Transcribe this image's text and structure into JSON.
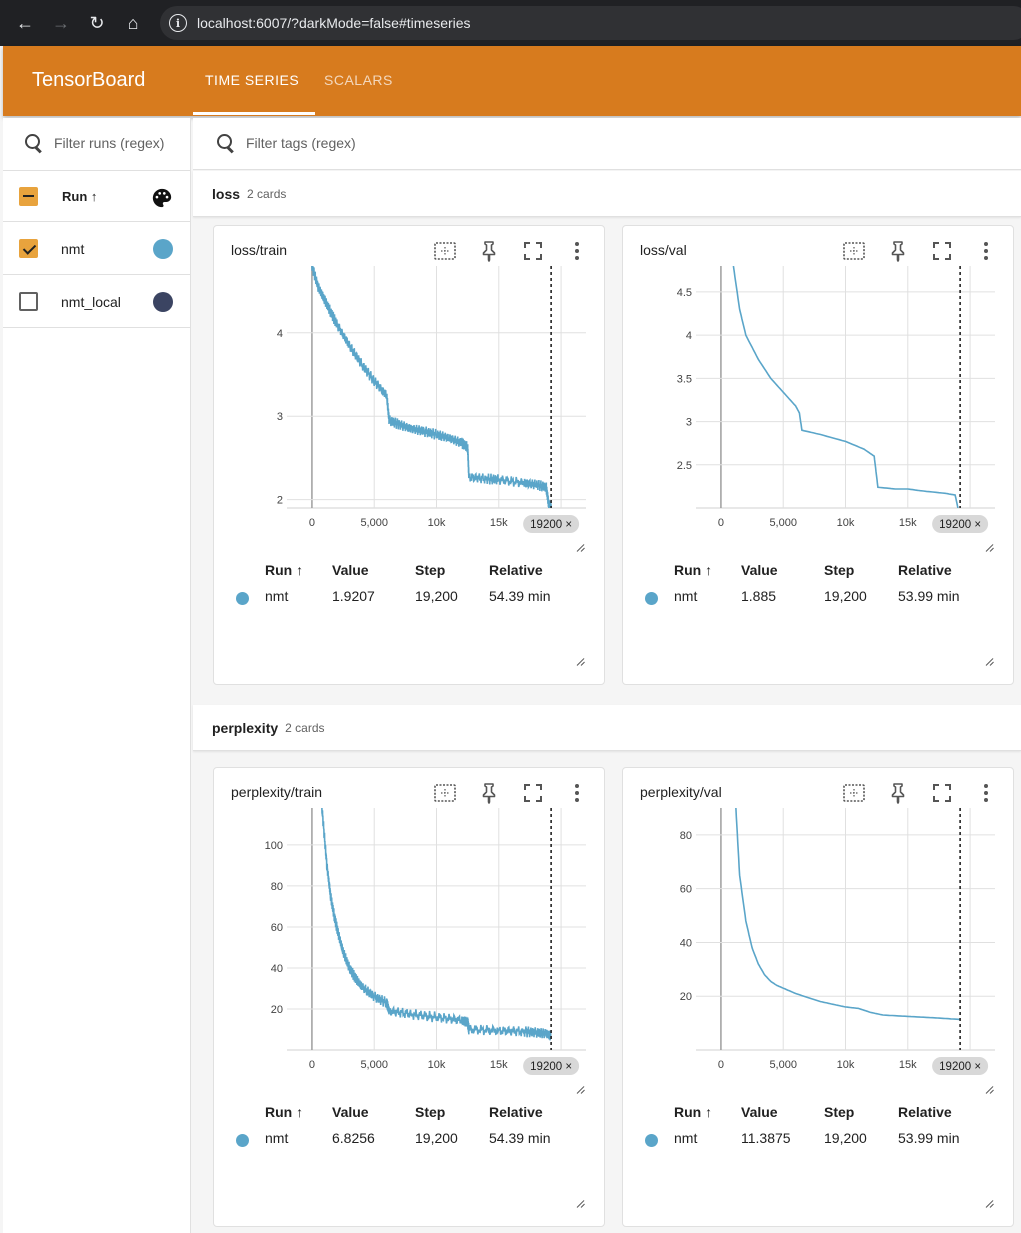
{
  "browser": {
    "url": "localhost:6007/?darkMode=false#timeseries",
    "info_icon": "i"
  },
  "app": {
    "brand": "TensorBoard",
    "tabs": [
      {
        "label": "TIME SERIES",
        "active": true
      },
      {
        "label": "SCALARS",
        "active": false
      }
    ],
    "accent": "#d77b1e"
  },
  "runs_pane": {
    "filter_placeholder": "Filter runs (regex)",
    "header_label": "Run ↑",
    "runs": [
      {
        "name": "nmt",
        "checked": true,
        "color": "#5aa5c9"
      },
      {
        "name": "nmt_local",
        "checked": false,
        "color": "#3b4462"
      }
    ]
  },
  "main": {
    "filter_placeholder": "Filter tags (regex)",
    "sections": [
      {
        "name": "loss",
        "count": "2 cards"
      },
      {
        "name": "perplexity",
        "count": "2 cards"
      }
    ],
    "legend_headers": {
      "run": "Run ↑",
      "value": "Value",
      "step": "Step",
      "relative": "Relative"
    }
  },
  "cards": [
    {
      "title": "loss/train",
      "run": "nmt",
      "value": "1.9207",
      "step": "19,200",
      "relative": "54.39 min",
      "marker": "19200 ×"
    },
    {
      "title": "loss/val",
      "run": "nmt",
      "value": "1.885",
      "step": "19,200",
      "relative": "53.99 min",
      "marker": "19200 ×"
    },
    {
      "title": "perplexity/train",
      "run": "nmt",
      "value": "6.8256",
      "step": "19,200",
      "relative": "54.39 min",
      "marker": "19200 ×"
    },
    {
      "title": "perplexity/val",
      "run": "nmt",
      "value": "11.3875",
      "step": "19,200",
      "relative": "53.99 min",
      "marker": "19200 ×"
    }
  ],
  "chart_data": [
    {
      "type": "line",
      "title": "loss/train",
      "series_color": "#5aa5c9",
      "noisy": true,
      "x_ticks": [
        "0",
        "5,000",
        "10k",
        "15k"
      ],
      "y_ticks": [
        "2",
        "3",
        "4"
      ],
      "xlim": [
        -2000,
        22000
      ],
      "ylim": [
        1.9,
        4.8
      ],
      "marker_step": 19200,
      "series": [
        {
          "x": [
            0,
            500,
            1000,
            1500,
            2000,
            3000,
            4000,
            5000,
            6000,
            6200,
            7000,
            8000,
            9000,
            10000,
            11000,
            12000,
            12500,
            12600,
            14000,
            15000,
            17000,
            18000,
            18800,
            19000,
            19200
          ],
          "y": [
            4.8,
            4.55,
            4.4,
            4.25,
            4.1,
            3.85,
            3.62,
            3.42,
            3.25,
            2.95,
            2.9,
            2.85,
            2.82,
            2.78,
            2.74,
            2.68,
            2.63,
            2.27,
            2.25,
            2.24,
            2.2,
            2.18,
            2.15,
            1.95,
            1.92
          ]
        }
      ]
    },
    {
      "type": "line",
      "title": "loss/val",
      "series_color": "#5aa5c9",
      "noisy": false,
      "x_ticks": [
        "0",
        "5,000",
        "10k",
        "15k"
      ],
      "y_ticks": [
        "2.5",
        "3",
        "3.5",
        "4",
        "4.5"
      ],
      "xlim": [
        -2000,
        22000
      ],
      "ylim": [
        2.0,
        4.8
      ],
      "marker_step": 19200,
      "series": [
        {
          "x": [
            1000,
            1500,
            2000,
            3000,
            4000,
            5000,
            6000,
            6300,
            6500,
            8000,
            10000,
            11500,
            12300,
            12600,
            14000,
            15000,
            16000,
            18000,
            18800,
            19200
          ],
          "y": [
            4.8,
            4.3,
            4.0,
            3.72,
            3.5,
            3.34,
            3.18,
            3.1,
            2.9,
            2.85,
            2.77,
            2.68,
            2.6,
            2.24,
            2.22,
            2.22,
            2.2,
            2.17,
            2.15,
            1.885
          ]
        }
      ]
    },
    {
      "type": "line",
      "title": "perplexity/train",
      "series_color": "#5aa5c9",
      "noisy": true,
      "x_ticks": [
        "0",
        "5,000",
        "10k",
        "15k"
      ],
      "y_ticks": [
        "20",
        "40",
        "60",
        "80",
        "100"
      ],
      "xlim": [
        -2000,
        22000
      ],
      "ylim": [
        0,
        118
      ],
      "marker_step": 19200,
      "series": [
        {
          "x": [
            800,
            1200,
            1500,
            1800,
            2100,
            2500,
            3000,
            3500,
            4000,
            5000,
            6000,
            6200,
            8000,
            10000,
            12000,
            12500,
            12600,
            15000,
            17000,
            18000,
            18800,
            19200
          ],
          "y": [
            118,
            90,
            75,
            65,
            57,
            48,
            40,
            35,
            31,
            26,
            23,
            19,
            17.5,
            16,
            14.5,
            13.5,
            10,
            9.5,
            9,
            8.5,
            8,
            6.83
          ]
        }
      ]
    },
    {
      "type": "line",
      "title": "perplexity/val",
      "series_color": "#5aa5c9",
      "noisy": false,
      "x_ticks": [
        "0",
        "5,000",
        "10k",
        "15k"
      ],
      "y_ticks": [
        "20",
        "40",
        "60",
        "80"
      ],
      "xlim": [
        -2000,
        22000
      ],
      "ylim": [
        0,
        90
      ],
      "marker_step": 19200,
      "series": [
        {
          "x": [
            1200,
            1500,
            2000,
            2500,
            3000,
            3500,
            4000,
            4500,
            5000,
            6000,
            7000,
            8000,
            9000,
            10000,
            11000,
            12000,
            13000,
            15000,
            17000,
            18000,
            19200
          ],
          "y": [
            90,
            65,
            48,
            38,
            32,
            28,
            25.5,
            24,
            23,
            21,
            19.5,
            18,
            17,
            16,
            15.5,
            14,
            13,
            12.5,
            12,
            11.7,
            11.39
          ]
        }
      ]
    }
  ]
}
